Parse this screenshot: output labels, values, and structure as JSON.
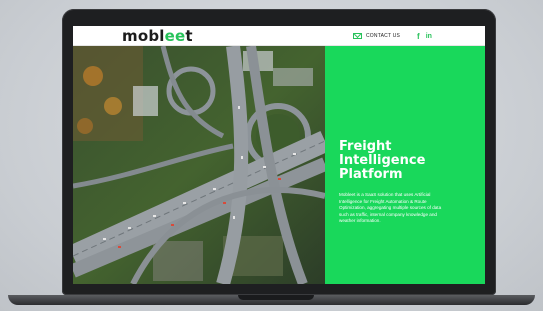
{
  "brand": {
    "logo_start": "mobl",
    "logo_accent": "ee",
    "logo_end": "t"
  },
  "nav": {
    "contact_label": "CONTACT US",
    "facebook_label": "f",
    "linkedin_label": "in"
  },
  "hero": {
    "title": "Freight\nIntelligence\nPlatform",
    "description": "Mobleet is a SaaS solution that uses Artificial Intelligence for Freight Automation & Route Optimization, aggregating multiple sources of data such as traffic, internal company knowledge and weather information."
  },
  "colors": {
    "accent": "#19d85b",
    "logo_text": "#1c1c1c"
  },
  "icons": [
    "mail-icon",
    "facebook-icon",
    "linkedin-icon"
  ]
}
